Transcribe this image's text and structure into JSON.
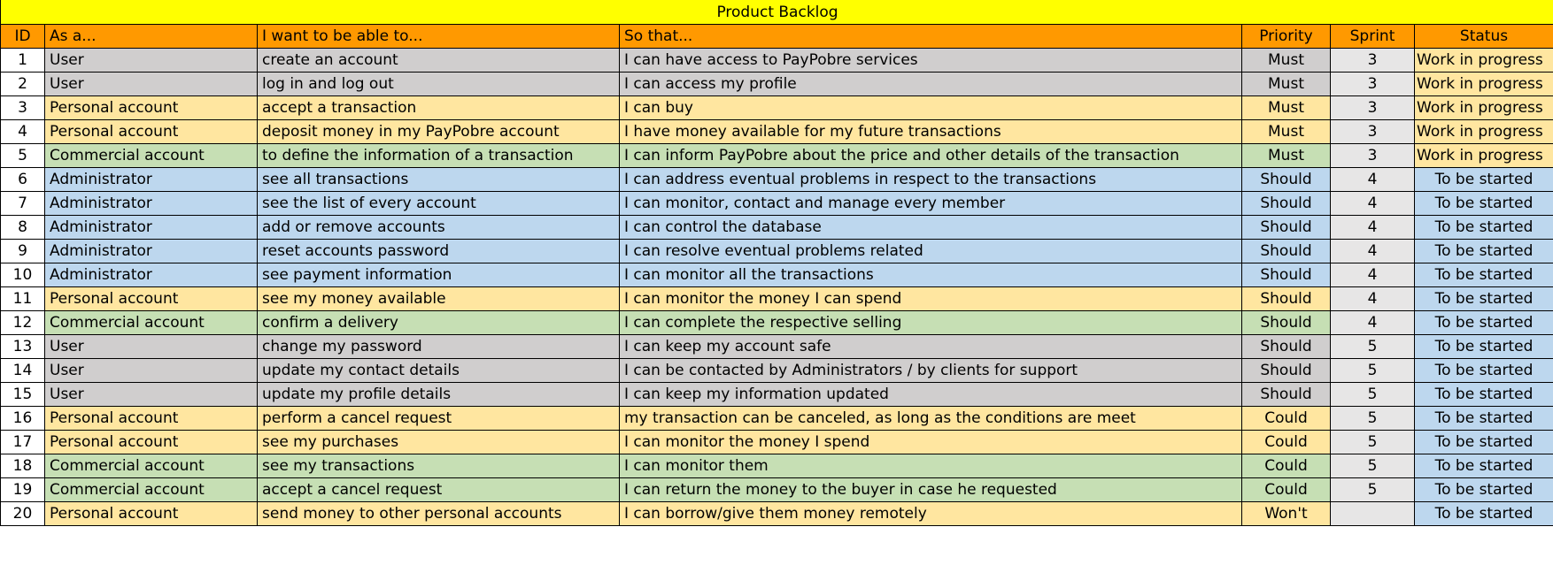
{
  "title": "Product Backlog",
  "headers": {
    "id": "ID",
    "as_a": "As a...",
    "want": "I want to be able to...",
    "so_that": "So that...",
    "priority": "Priority",
    "sprint": "Sprint",
    "status": "Status"
  },
  "colors": {
    "title_bg": "#ffff00",
    "header_bg": "#ff9900",
    "user": "#d0cece",
    "personal": "#ffe6a0",
    "commercial": "#c6dfb4",
    "administrator": "#bdd7ee",
    "sprint_bg": "#e7e6e6"
  },
  "rows": [
    {
      "id": "1",
      "role": "User",
      "want": "create an account",
      "so_that": "I can have access to PayPobre services",
      "priority": "Must",
      "sprint": "3",
      "status": "Work in progress",
      "kind": "user"
    },
    {
      "id": "2",
      "role": "User",
      "want": "log in and log out",
      "so_that": "I can access my profile",
      "priority": "Must",
      "sprint": "3",
      "status": "Work in progress",
      "kind": "user"
    },
    {
      "id": "3",
      "role": "Personal account",
      "want": "accept a transaction",
      "so_that": "I can buy",
      "priority": "Must",
      "sprint": "3",
      "status": "Work in progress",
      "kind": "personal"
    },
    {
      "id": "4",
      "role": "Personal account",
      "want": "deposit money in my PayPobre account",
      "so_that": "I have money available for my future transactions",
      "priority": "Must",
      "sprint": "3",
      "status": "Work in progress",
      "kind": "personal"
    },
    {
      "id": "5",
      "role": "Commercial account",
      "want": "to define the information of a transaction",
      "so_that": "I can inform PayPobre about the price and other details of the transaction",
      "priority": "Must",
      "sprint": "3",
      "status": "Work in progress",
      "kind": "commercial"
    },
    {
      "id": "6",
      "role": "Administrator",
      "want": "see all transactions",
      "so_that": "I can address eventual problems in respect to the transactions",
      "priority": "Should",
      "sprint": "4",
      "status": "To be started",
      "kind": "admin"
    },
    {
      "id": "7",
      "role": "Administrator",
      "want": "see the list of every account",
      "so_that": "I can monitor, contact and manage every member",
      "priority": "Should",
      "sprint": "4",
      "status": "To be started",
      "kind": "admin"
    },
    {
      "id": "8",
      "role": "Administrator",
      "want": "add or remove accounts",
      "so_that": "I can control the database",
      "priority": "Should",
      "sprint": "4",
      "status": "To be started",
      "kind": "admin"
    },
    {
      "id": "9",
      "role": "Administrator",
      "want": "reset accounts password",
      "so_that": "I can resolve eventual problems related",
      "priority": "Should",
      "sprint": "4",
      "status": "To be started",
      "kind": "admin"
    },
    {
      "id": "10",
      "role": "Administrator",
      "want": "see payment information",
      "so_that": "I can monitor all the transactions",
      "priority": "Should",
      "sprint": "4",
      "status": "To be started",
      "kind": "admin"
    },
    {
      "id": "11",
      "role": "Personal account",
      "want": "see my money available",
      "so_that": "I can monitor the money I can spend",
      "priority": "Should",
      "sprint": "4",
      "status": "To be started",
      "kind": "personal"
    },
    {
      "id": "12",
      "role": "Commercial account",
      "want": "confirm a delivery",
      "so_that": "I can complete the respective selling",
      "priority": "Should",
      "sprint": "4",
      "status": "To be started",
      "kind": "commercial"
    },
    {
      "id": "13",
      "role": "User",
      "want": "change my password",
      "so_that": "I can keep my account safe",
      "priority": "Should",
      "sprint": "5",
      "status": "To be started",
      "kind": "user"
    },
    {
      "id": "14",
      "role": "User",
      "want": "update my contact details",
      "so_that": "I can be contacted by Administrators / by clients for support",
      "priority": "Should",
      "sprint": "5",
      "status": "To be started",
      "kind": "user"
    },
    {
      "id": "15",
      "role": "User",
      "want": "update my profile details",
      "so_that": "I can keep my information updated",
      "priority": "Should",
      "sprint": "5",
      "status": "To be started",
      "kind": "user"
    },
    {
      "id": "16",
      "role": "Personal account",
      "want": "perform a cancel request",
      "so_that": "my transaction can be canceled, as long as the conditions are meet",
      "priority": "Could",
      "sprint": "5",
      "status": "To be started",
      "kind": "personal"
    },
    {
      "id": "17",
      "role": "Personal account",
      "want": "see my purchases",
      "so_that": "I can monitor the money I spend",
      "priority": "Could",
      "sprint": "5",
      "status": "To be started",
      "kind": "personal"
    },
    {
      "id": "18",
      "role": "Commercial account",
      "want": "see my transactions",
      "so_that": "I can monitor them",
      "priority": "Could",
      "sprint": "5",
      "status": "To be started",
      "kind": "commercial"
    },
    {
      "id": "19",
      "role": "Commercial account",
      "want": "accept a cancel request",
      "so_that": "I can return the money to the buyer in case he requested",
      "priority": "Could",
      "sprint": "5",
      "status": "To be started",
      "kind": "commercial"
    },
    {
      "id": "20",
      "role": "Personal account",
      "want": "send money to other personal accounts",
      "so_that": "I can borrow/give them money remotely",
      "priority": "Won't",
      "sprint": "",
      "status": "To be started",
      "kind": "personal"
    }
  ]
}
